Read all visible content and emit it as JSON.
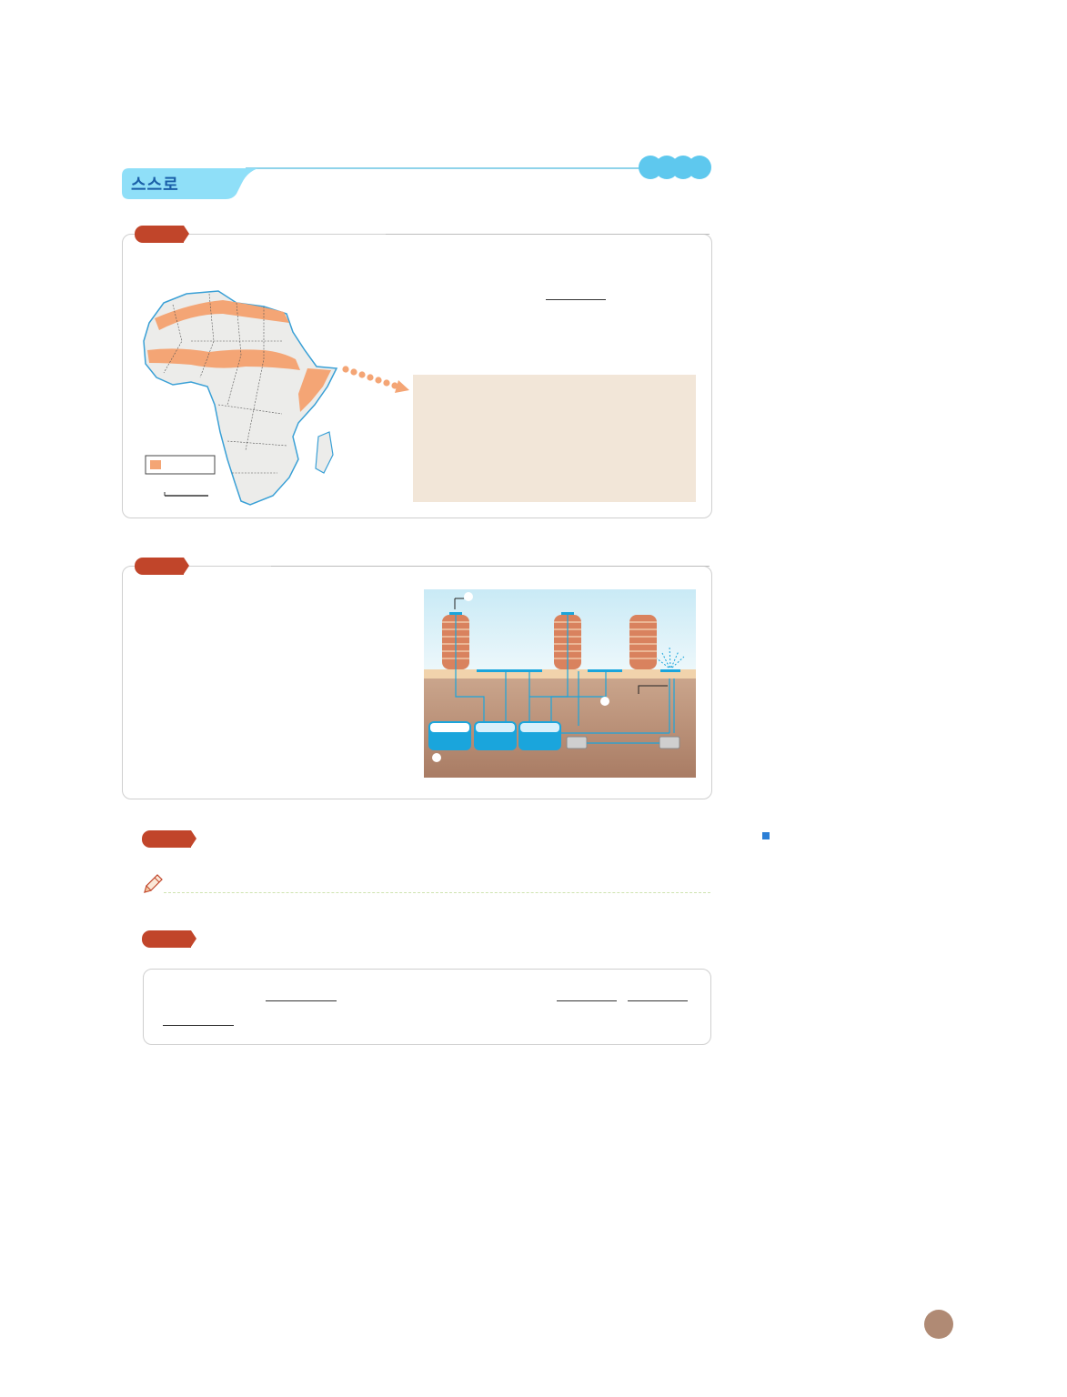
{
  "header": {
    "title": "스스로",
    "pill_color": "#5ec8ee",
    "tab_color": "#8fdff8",
    "title_color": "#1a5fa8"
  },
  "colors": {
    "tag": "#c1452a",
    "desert_band": "#f4a575",
    "text_panel": "#f2e6d8",
    "water": "#1aa5dc",
    "page_badge": "#b08a74",
    "bullet": "#2b7fd6"
  },
  "icons": {
    "pencil": "pencil-icon",
    "map": "africa-map",
    "arrow": "dotted-arrow-icon",
    "diagram": "water-recycling-diagram"
  }
}
